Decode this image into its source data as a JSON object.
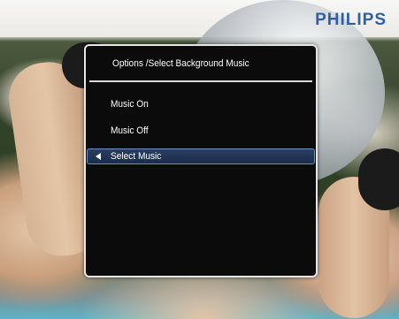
{
  "brand": {
    "name": "PHILIPS"
  },
  "dialog": {
    "title": "Options /Select Background Music",
    "items": [
      {
        "label": "Music On"
      },
      {
        "label": "Music Off"
      },
      {
        "label": "Select Music",
        "selected": true
      }
    ]
  },
  "icons": {
    "selected_indicator": "left-arrow-icon"
  },
  "colors": {
    "brand": "#2f5fa6",
    "dialog_background": "#0b0b0b",
    "dialog_border": "#e6e6e6",
    "highlight": "#2b3e61",
    "highlight_border": "#6d90c8",
    "text": "#ffffff"
  }
}
